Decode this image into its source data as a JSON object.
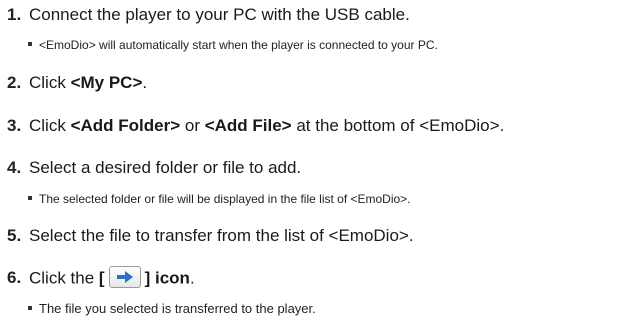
{
  "steps": [
    {
      "num": "1.",
      "text": "Connect the player to your PC with the USB cable.",
      "note": "<EmoDio> will automatically start when the player is connected to your PC."
    },
    {
      "num": "2.",
      "pre": "Click ",
      "bold": "<My PC>",
      "post": "."
    },
    {
      "num": "3.",
      "pre": "Click ",
      "bold1": "<Add Folder>",
      "mid": " or ",
      "bold2": "<Add File>",
      "post": " at the bottom of <EmoDio>."
    },
    {
      "num": "4.",
      "text": "Select a desired folder or file to add.",
      "note": "The selected folder or file will be displayed in the file list of <EmoDio>."
    },
    {
      "num": "5.",
      "text": "Select the file to transfer from the list of <EmoDio>."
    },
    {
      "num": "6.",
      "pre": "Click the ",
      "bold_open": "[",
      "bold_close": "] icon",
      "post": ".",
      "icon": "right-arrow-icon",
      "note": "The file you selected is transferred to the player."
    }
  ],
  "colors": {
    "arrow": "#2a6fc9",
    "text": "#1a1a1a"
  }
}
